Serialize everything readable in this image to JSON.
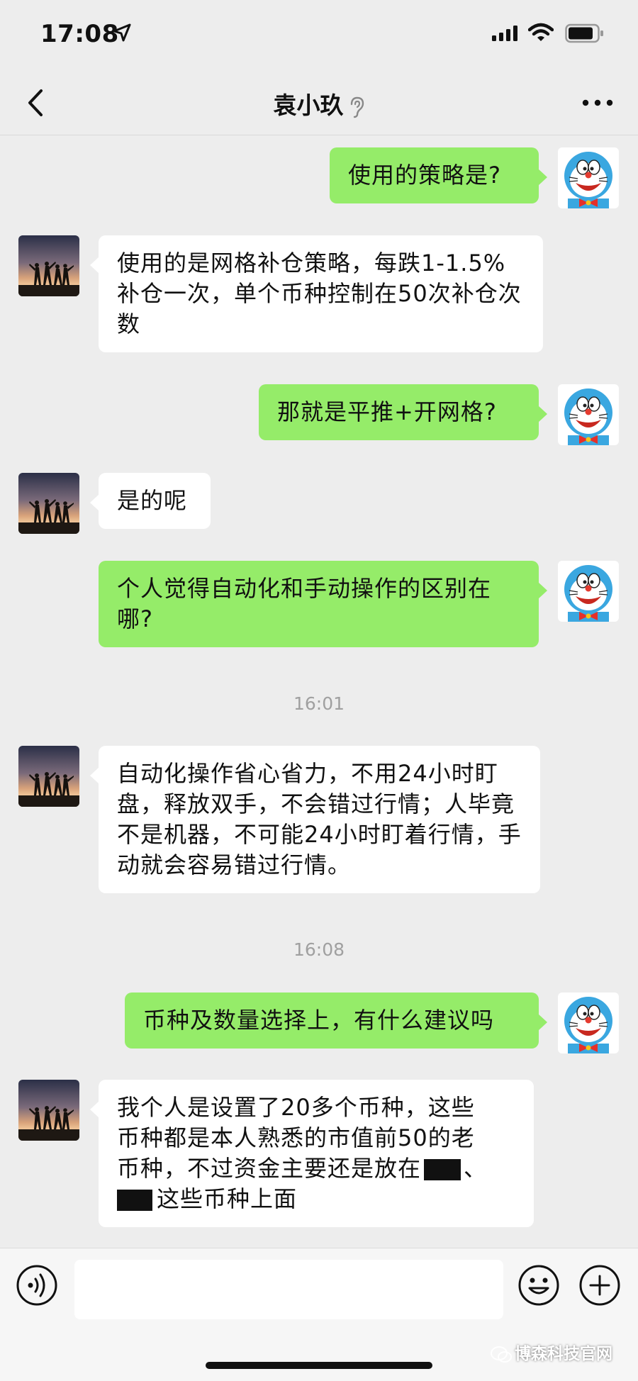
{
  "status_bar": {
    "time": "17:08"
  },
  "header": {
    "title": "袁小玖"
  },
  "messages": [
    {
      "from": "me",
      "text": "使用的策略是?"
    },
    {
      "from": "contact",
      "text": "使用的是网格补仓策略，每跌1-1.5%补仓一次，单个币种控制在50次补仓次数"
    },
    {
      "from": "me",
      "text": "那就是平推+开网格?"
    },
    {
      "from": "contact",
      "text": "是的呢"
    },
    {
      "from": "me",
      "text": "个人觉得自动化和手动操作的区别在哪?"
    },
    {
      "type": "timestamp",
      "text": "16:01"
    },
    {
      "from": "contact",
      "text": "自动化操作省心省力，不用24小时盯盘，释放双手，不会错过行情；人毕竟不是机器，不可能24小时盯着行情，手动就会容易错过行情。"
    },
    {
      "type": "timestamp",
      "text": "16:08"
    },
    {
      "from": "me",
      "text": "币种及数量选择上，有什么建议吗"
    },
    {
      "from": "contact",
      "line1": "我个人是设置了20多个币种，这些",
      "line2": "币种都是本人熟悉的市值前50的老",
      "line3a": "币种，不过资金主要还是放在",
      "line3b": "、",
      "line4": "这些币种上面"
    }
  ],
  "input_bar": {
    "text_value": ""
  },
  "watermark": "博森科技官网",
  "icons": [
    "location-arrow-icon",
    "signal-icon",
    "wifi-icon",
    "battery-icon",
    "back-chevron-icon",
    "ear-icon",
    "more-dots-icon",
    "voice-icon",
    "emoji-icon",
    "plus-icon"
  ],
  "colors": {
    "background": "#ededed",
    "outgoing_bubble": "#95ec69",
    "incoming_bubble": "#ffffff",
    "timestamp": "#a0a0a0"
  }
}
